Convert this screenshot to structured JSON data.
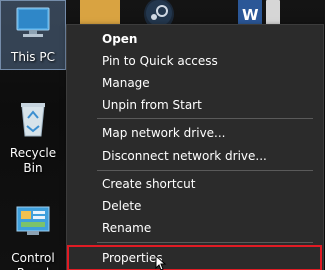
{
  "desktop": {
    "icons": [
      {
        "label": "This PC",
        "icon": "this-pc-icon"
      },
      {
        "label": "Recycle Bin",
        "icon": "recycle-bin-icon"
      },
      {
        "label": "Control Panel",
        "icon": "control-panel-icon"
      }
    ],
    "top_icons": [
      "folder-icon",
      "steam-icon",
      "word-document-icon"
    ]
  },
  "context_menu": {
    "items": [
      {
        "label": "Open",
        "bold": true
      },
      {
        "label": "Pin to Quick access"
      },
      {
        "label": "Manage"
      },
      {
        "label": "Unpin from Start"
      },
      {
        "label": "Map network drive..."
      },
      {
        "label": "Disconnect network drive..."
      },
      {
        "label": "Create shortcut"
      },
      {
        "label": "Delete"
      },
      {
        "label": "Rename"
      },
      {
        "label": "Properties",
        "highlighted": true
      }
    ],
    "highlight_color": "#e01b24"
  }
}
